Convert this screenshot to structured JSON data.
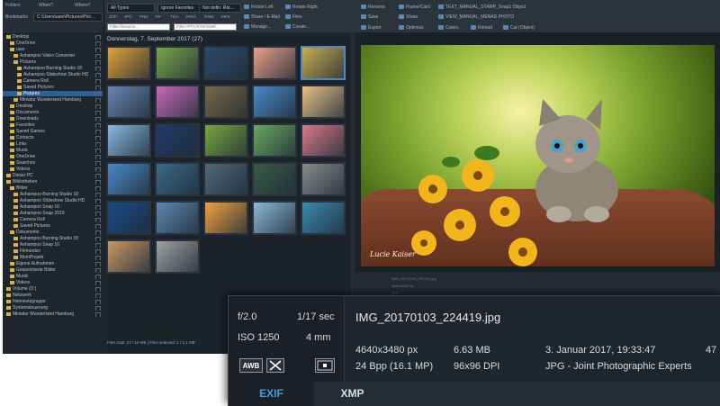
{
  "toolbar": {
    "left_tabs": [
      "Folders",
      "When?",
      "Where?"
    ],
    "bookmarks_label": "Bookmarks",
    "address": "C:\\Users\\user\\Pictures\\Pict...",
    "type_filter": "All Types",
    "sort_select": "Ignore Favorites",
    "label_select": "Not defin: Rat...",
    "type_chips": [
      "JGP",
      "JPG",
      "PNG",
      "TIF",
      "TGA",
      "JPEG",
      "RAW",
      "MP4"
    ],
    "filter_name_placeholder": "Filter filename...",
    "filter_exif_placeholder": "Filter IPTC/EXIF/XMP...",
    "buttons_mid": [
      "Rotate Left",
      "Rotate Right",
      "Share / E-Mail",
      "Files",
      "Manage...",
      "Create..."
    ],
    "buttons_right_row1": [
      "Rename",
      "Frame/Card",
      "TEXT_MANUAL_STAMP_Snap1 Object"
    ],
    "buttons_right_row2": [
      "Save",
      "Share",
      "VIEW_MANUAL_MENAD PHOTO"
    ],
    "buttons_right_row3": [
      "Export",
      "Optimize",
      "Colors",
      "Reload",
      "Cut (Object)"
    ]
  },
  "tree": {
    "items": [
      "Desktop",
      "OneDrive",
      "user",
      "Ashampoo Video Converter",
      "Pictures",
      "Ashampoo Burning Studio 18",
      "Ashampoo Slideshow Studio HD",
      "Camera Roll",
      "Saved Pictures",
      "Pictures",
      "Miniatur Wunderland Hamburg",
      "Desktop",
      "Documents",
      "Downloads",
      "Favorites",
      "Saved Games",
      "Contacts",
      "Links",
      "Music",
      "OneDrive",
      "Searches",
      "Videos",
      "Dieser PC",
      "Bibliotheken",
      "Bilder",
      "Ashampoo Burning Studio 18",
      "Ashampoo Slideshow Studio HD",
      "Ashampoo Snap 10",
      "Ashampoo Snap 2019",
      "Camera Roll",
      "Saved Pictures",
      "Dokumente",
      "Ashampoo Burning Studio 18",
      "Ashampoo Snap 10",
      "Filmundso",
      "MeinProjekt",
      "Eigene Aufnahmen",
      "Gespeicherte Bilder",
      "Musik",
      "Videos",
      "Volume (D:)",
      "Netzwerk",
      "Heimnetzgruppe",
      "Systemsteuerung",
      "Miniatur Wunderland Hamburg"
    ],
    "selected_index": 9
  },
  "thumbs": {
    "date_header": "Donnerstag, 7. September 2017 (27)",
    "colors": [
      [
        "#e0a23a",
        "#7aa64a",
        "#2c4a6a",
        "#e8a08a",
        "#c8ac50"
      ],
      [
        "#6a86b4",
        "#c86ab8",
        "#7a6848",
        "#4a8ac8",
        "#e8c088"
      ],
      [
        "#88b8e0",
        "#203a68",
        "#78a840",
        "#6aa860",
        "#d87a8a"
      ],
      [
        "#4a88c8",
        "#3a6a8a",
        "#506878",
        "#3a5a48",
        "#8a8a88"
      ],
      [
        "#1a4a88",
        "#5a88b0",
        "#f0a040",
        "#88b8d8",
        "#3a8ab0"
      ],
      [
        "#c89868",
        "#a0a0a0"
      ]
    ],
    "status": "Files total: 27 / 16 MB | Files selected: 1 / 1.1 MB"
  },
  "preview": {
    "signature": "Lucie Kaiser",
    "strip_lines": [
      "IMG_20170103_224419.jpg",
      "4640x3480 px",
      "JPG"
    ]
  },
  "info": {
    "aperture": "f/2.0",
    "shutter": "1/17 sec",
    "iso": "ISO 1250",
    "focal": "4 mm",
    "badge_awb": "AWB",
    "filename": "IMG_20170103_224419.jpg",
    "dimensions": "4640x3480 px",
    "bpp": "24 Bpp (16.1 MP)",
    "filesize": "6.63 MB",
    "dpi": "96x96 DPI",
    "date": "3. Januar 2017, 19:33:47",
    "format": "JPG - Joint Photographic Experts",
    "extra": "47",
    "tabs": [
      "EXIF",
      "XMP"
    ],
    "active_tab": "EXIF"
  },
  "colors": {
    "accent": "#4b9be0",
    "selection": "#2f5f94",
    "panel_bg": "#1f252d"
  }
}
